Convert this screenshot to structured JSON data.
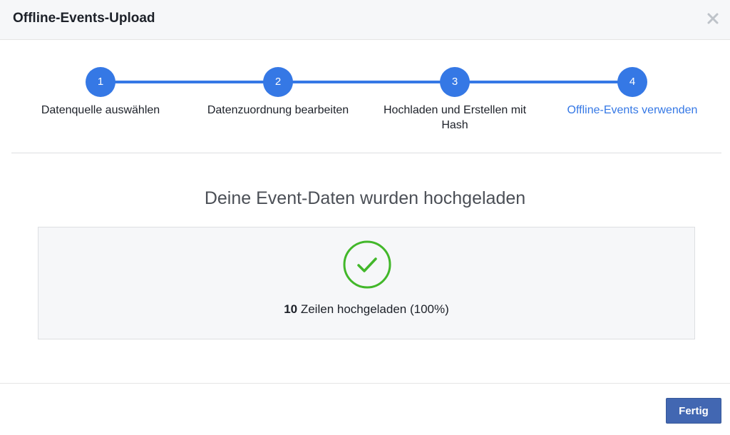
{
  "dialog": {
    "title": "Offline-Events-Upload"
  },
  "stepper": {
    "steps": [
      {
        "number": "1",
        "label": "Datenquelle auswählen"
      },
      {
        "number": "2",
        "label": "Datenzuordnung bearbeiten"
      },
      {
        "number": "3",
        "label": "Hochladen und Erstellen mit Hash"
      },
      {
        "number": "4",
        "label": "Offline-Events verwenden"
      }
    ],
    "active_step": 4
  },
  "main": {
    "title": "Deine Event-Daten wurden hochgeladen",
    "result_count": "10",
    "result_text": " Zeilen hochgeladen (100%)"
  },
  "footer": {
    "done_label": "Fertig"
  },
  "colors": {
    "accent": "#3578e5",
    "success": "#42b72a",
    "primary_button": "#4267b2"
  },
  "icons": {
    "close": "close-icon",
    "success": "check-circle-icon"
  }
}
